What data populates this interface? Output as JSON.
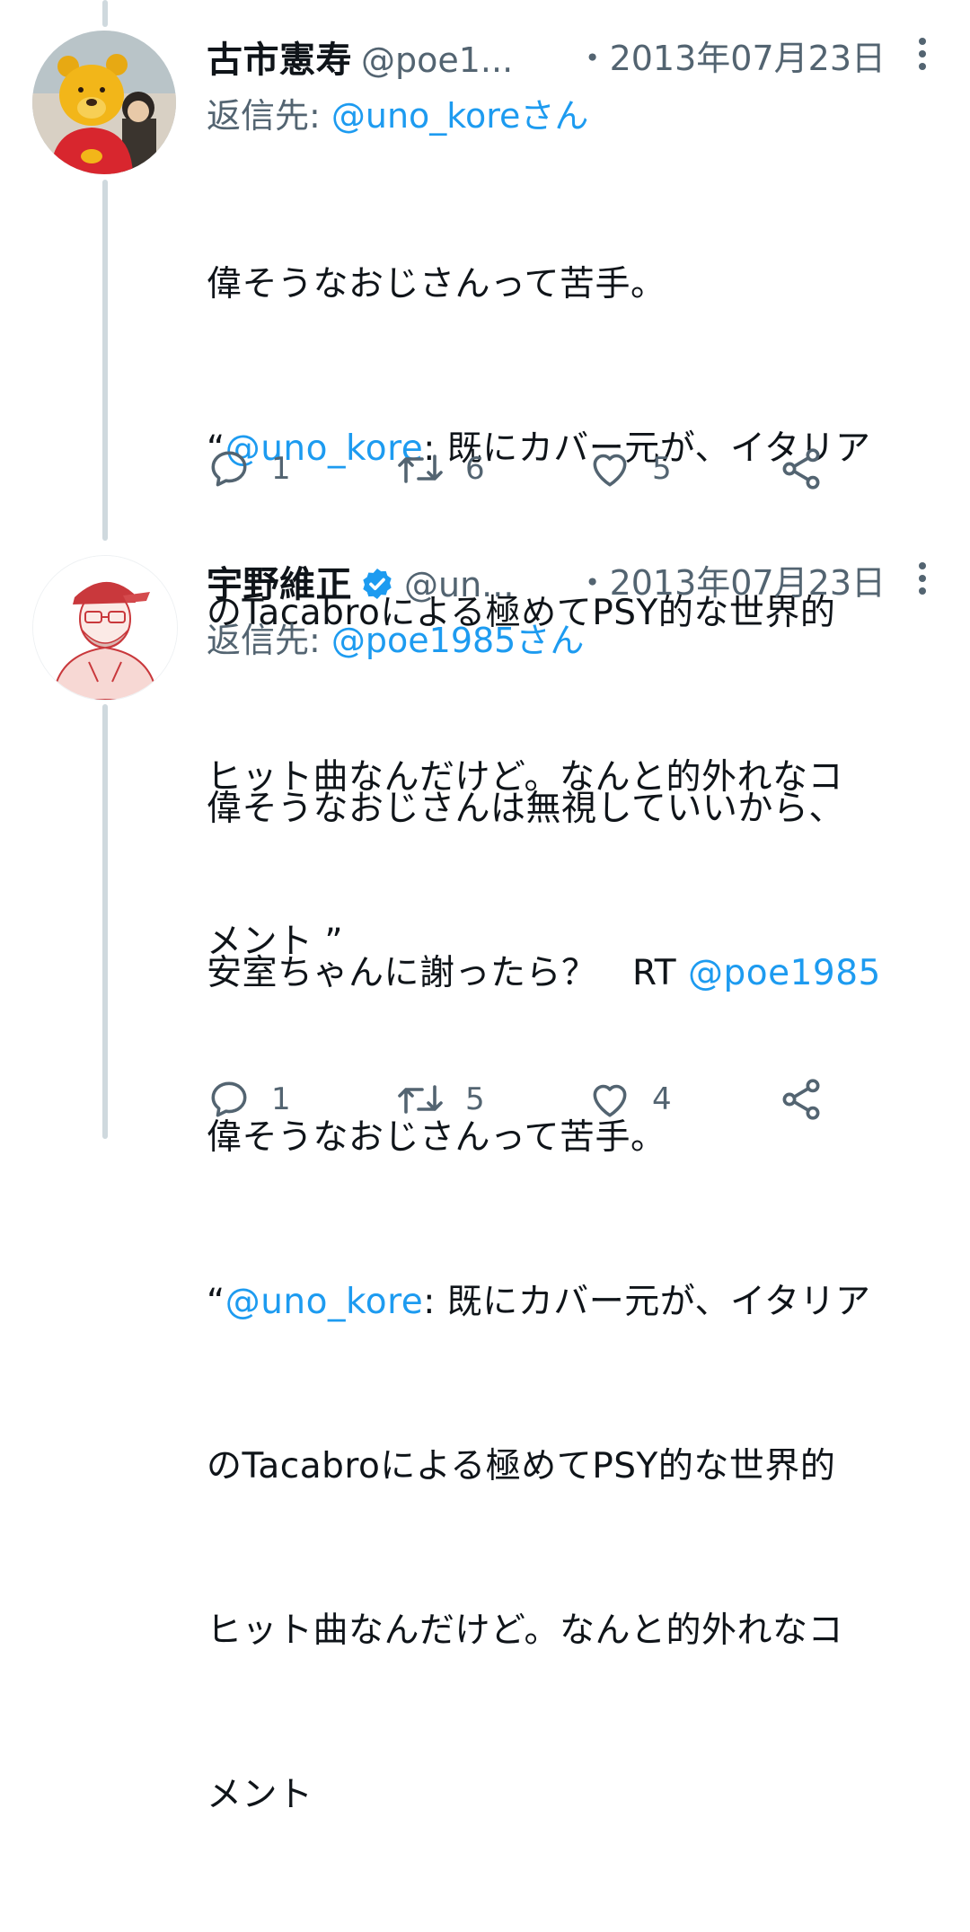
{
  "tweets": [
    {
      "display_name": "古市憲寿",
      "handle": "@poe1...",
      "date": "・2013年07月23日",
      "replying_prefix": "返信先: ",
      "replying_to": "@uno_koreさん",
      "lines": {
        "l1": "偉そうなおじさんって苦手。",
        "l2_open": "“",
        "l2_mention": "@uno_kore",
        "l2_rest": ": 既にカバー元が、イタリア",
        "l3": "のTacabroによる極めてPSY的な世界的",
        "l4": "ヒット曲なんだけど。なんと的外れなコ",
        "l5": "メント ”"
      },
      "reply_count": "1",
      "retweet_count": "6",
      "like_count": "5",
      "avatar_icon": "winnie-the-pooh-photo-avatar"
    },
    {
      "display_name": "宇野維正",
      "handle": "@un...",
      "date": "・2013年07月23日",
      "replying_prefix": "返信先: ",
      "replying_to": "@poe1985さん",
      "lines": {
        "l1": "偉そうなおじさんは無視していいから、",
        "l2": "安室ちゃんに謝ったら？　RT ",
        "l2_mention": "@poe1985",
        "l3": "偉そうなおじさんって苦手。",
        "l4_open": "“",
        "l4_mention": "@uno_kore",
        "l4_rest": ": 既にカバー元が、イタリア",
        "l5": "のTacabroによる極めてPSY的な世界的",
        "l6": "ヒット曲なんだけど。なんと的外れなコ",
        "l7": "メント"
      },
      "reply_count": "1",
      "retweet_count": "5",
      "like_count": "4",
      "avatar_icon": "illustrated-man-red-cap-avatar"
    }
  ],
  "colors": {
    "link": "#1d9bf0",
    "secondary_text": "#536471",
    "thread_line": "#cfd9de",
    "verified": "#1d9bf0"
  }
}
